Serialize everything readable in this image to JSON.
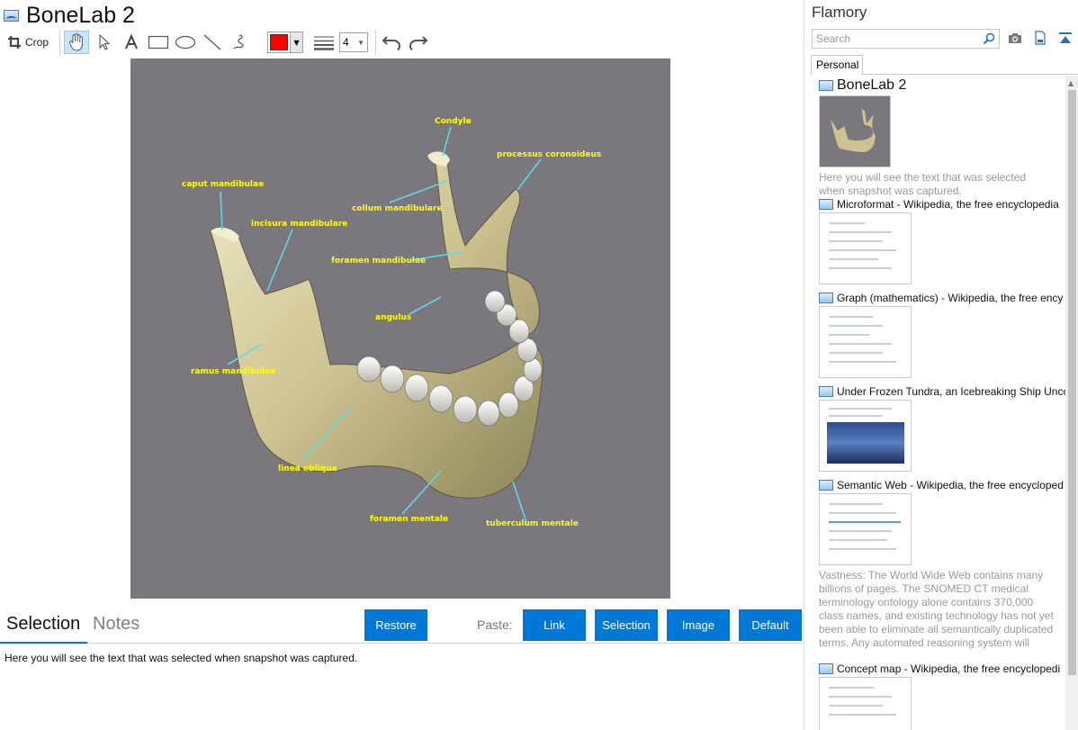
{
  "window": {
    "title": "BoneLab 2"
  },
  "toolbar": {
    "crop_label": "Crop",
    "line_width_value": "4",
    "tools": [
      "hand-icon",
      "pointer-icon",
      "text-icon",
      "rectangle-icon",
      "ellipse-icon",
      "line-icon",
      "freehand-icon"
    ],
    "color": "#ff0000"
  },
  "image": {
    "labels": {
      "condyle": "Condyle",
      "processus": "processus coronoideus",
      "caput": "caput mandibulae",
      "collum": "collum mandibulare",
      "incisura": "incisura mandibulare",
      "foramen_mandibulae": "foramen mandibulae",
      "angulus": "angulus",
      "ramus": "ramus mandibulae",
      "linea": "linea obliqua",
      "foramen_mentale": "foramen mentale",
      "tuberculum": "tuberculum mentale"
    },
    "background": "#7b777f",
    "label_color": "#ffff00",
    "leader_color": "#5fd8e8"
  },
  "bottom": {
    "tabs": [
      "Selection",
      "Notes"
    ],
    "restore_label": "Restore",
    "paste_label": "Paste:",
    "paste_buttons": [
      "Link",
      "Selection",
      "Image",
      "Default"
    ],
    "selection_text": "Here you will see the text that was selected when snapshot was captured."
  },
  "sidebar": {
    "title": "Flamory",
    "search_placeholder": "Search",
    "tab": "Personal",
    "items": [
      {
        "title": "BoneLab 2",
        "desc": "Here you will see the text that was selected when snapshot was captured."
      },
      {
        "title": "Microformat - Wikipedia, the free encyclopedia"
      },
      {
        "title": "Graph (mathematics) - Wikipedia, the free ency"
      },
      {
        "title": "Under Frozen Tundra, an Icebreaking Ship Unco"
      },
      {
        "title": "Semantic Web - Wikipedia, the free encycloped",
        "desc": "Vastness: The World Wide Web contains many billions of pages. The SNOMED CT medical terminology ontology alone contains 370,000 class names, and existing technology has not yet been able to eliminate all semantically duplicated terms. Any automated reasoning system will have to deal with truly huge inputs."
      },
      {
        "title": "Concept map - Wikipedia, the free encyclopedi"
      }
    ]
  },
  "colors": {
    "accent": "#0078d7"
  }
}
